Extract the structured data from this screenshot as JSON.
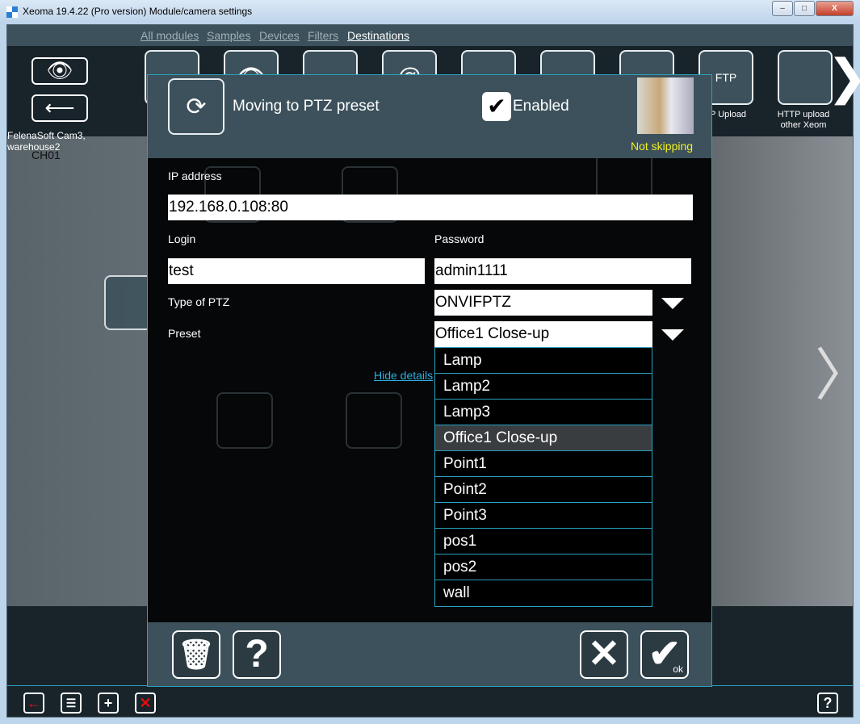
{
  "window": {
    "title": "Xeoma 19.4.22 (Pro version) Module/camera settings",
    "minimize": "–",
    "maximize": "□",
    "close": "X"
  },
  "nav": {
    "tabs": [
      "All modules",
      "Samples",
      "Devices",
      "Filters",
      "Destinations"
    ],
    "active": "Destinations"
  },
  "toolbar": {
    "camera_name": "FelenaSoft Cam3, warehouse2",
    "labels": [
      "P Upload",
      "HTTP upload other Xeom"
    ]
  },
  "camera": {
    "channel": "CH01"
  },
  "dialog": {
    "title": "Moving to PTZ preset",
    "enabled_label": "Enabled",
    "enabled": true,
    "status": "Not skipping",
    "ip_label": "IP address",
    "ip_value": "192.168.0.108:80",
    "login_label": "Login",
    "login_value": "test",
    "password_label": "Password",
    "password_value": "admin1111",
    "ptz_type_label": "Type of PTZ",
    "ptz_type_value": "ONVIFPTZ",
    "preset_label": "Preset",
    "preset_value": "Office1 Close-up",
    "hide_details": "Hide details",
    "preset_options": [
      "Lamp",
      "Lamp2",
      "Lamp3",
      "Office1 Close-up",
      "Point1",
      "Point2",
      "Point3",
      "pos1",
      "pos2",
      "wall"
    ],
    "ok_label": "ok"
  },
  "colors": {
    "accent": "#2aa0c0",
    "status": "#f0f020",
    "panel": "#3c515b"
  }
}
